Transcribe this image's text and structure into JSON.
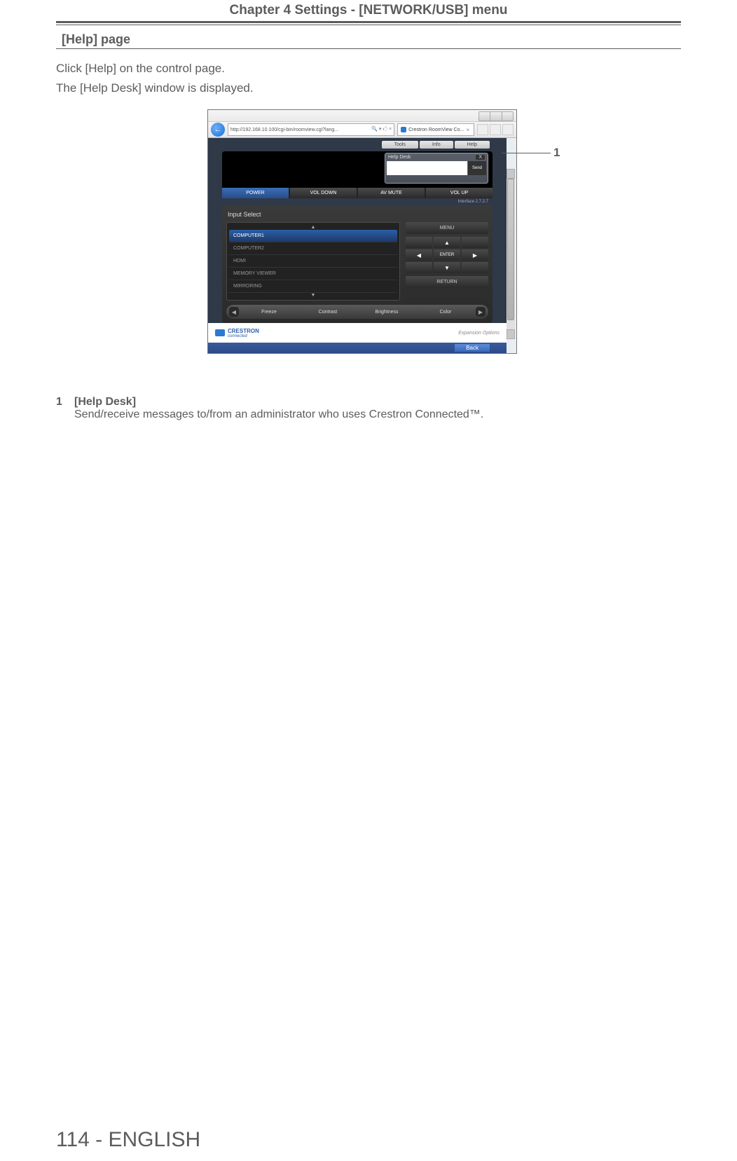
{
  "header": {
    "chapter": "Chapter 4   Settings - [NETWORK/USB] menu"
  },
  "section": {
    "title": "[Help] page"
  },
  "body": {
    "line1": "Click [Help] on the control page.",
    "line2": "The [Help Desk] window is displayed."
  },
  "callout": {
    "num": "1"
  },
  "legend": {
    "num": "1",
    "title": "[Help Desk]",
    "desc": "Send/receive messages to/from an administrator who uses Crestron Connected™."
  },
  "footer": {
    "page": "114 - ENGLISH"
  },
  "screenshot": {
    "url": "http://192.168.10.100/cgi-bin/roomview.cgi?lang...",
    "tab": "Crestron RoomView Co...",
    "top_tabs": {
      "tools": "Tools",
      "info": "Info",
      "help": "Help"
    },
    "helpdesk": {
      "title": "Help Desk",
      "close": "X",
      "send": "Send"
    },
    "mainbuttons": {
      "power": "POWER",
      "voldown": "VOL DOWN",
      "avmute": "AV MUTE",
      "volup": "VOL UP"
    },
    "interface": "Interface 2.7.2.7",
    "panel_title": "Input Select",
    "inputs": {
      "computer1": "COMPUTER1",
      "computer2": "COMPUTER2",
      "hdmi": "HDMI",
      "memory": "MEMORY VIEWER",
      "mirroring": "MIRRORING"
    },
    "controls": {
      "menu": "MENU",
      "enter": "ENTER",
      "return": "RETURN"
    },
    "bottom": {
      "freeze": "Freeze",
      "contrast": "Contrast",
      "brightness": "Brightness",
      "color": "Color"
    },
    "footer": {
      "brand": "CRESTRON",
      "connected": "connected",
      "expansion": "Expansion Options"
    },
    "back": "Back"
  }
}
